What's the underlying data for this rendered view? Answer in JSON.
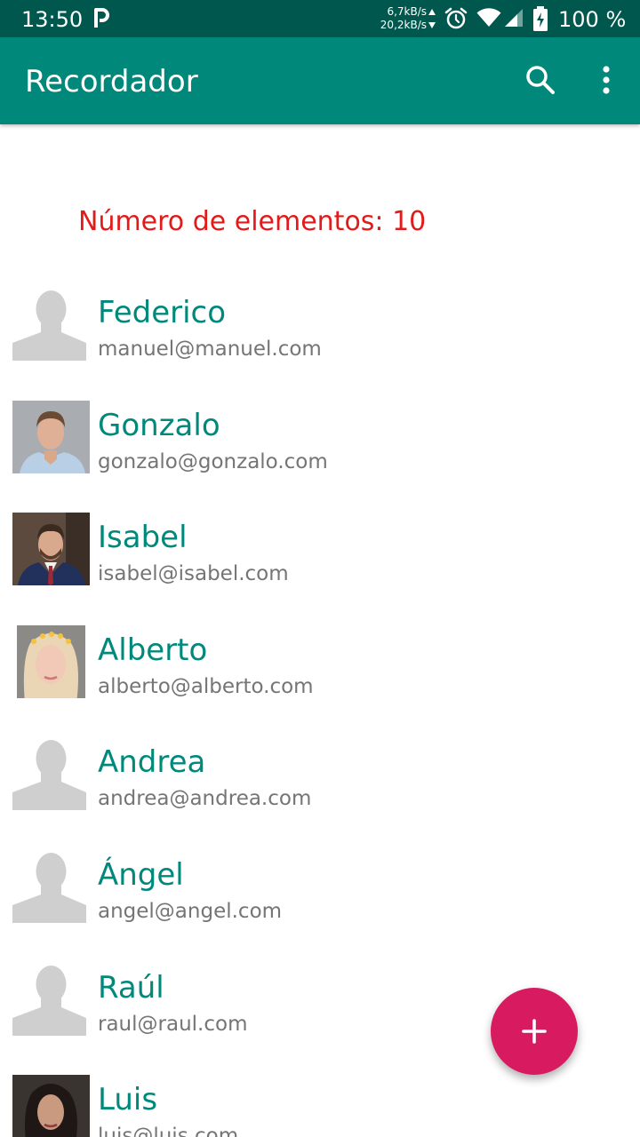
{
  "status_bar": {
    "time": "13:50",
    "net_up": "6,7kB/s",
    "net_down": "20,2kB/s",
    "battery_pct": "100 %",
    "icons": [
      "p-icon",
      "alarm-icon",
      "wifi-icon",
      "signal-icon",
      "battery-charging-icon"
    ]
  },
  "app_bar": {
    "title": "Recordador",
    "actions": [
      "search-icon",
      "more-vert-icon"
    ]
  },
  "counter": {
    "label": "Número de elementos: 10"
  },
  "contacts": [
    {
      "name": "Federico",
      "email": "manuel@manuel.com",
      "avatar": "placeholder"
    },
    {
      "name": "Gonzalo",
      "email": "gonzalo@gonzalo.com",
      "avatar": "photo-man-blue-shirt"
    },
    {
      "name": "Isabel",
      "email": "isabel@isabel.com",
      "avatar": "photo-man-suit"
    },
    {
      "name": "Alberto",
      "email": "alberto@alberto.com",
      "avatar": "photo-woman-blonde"
    },
    {
      "name": "Andrea",
      "email": "andrea@andrea.com",
      "avatar": "placeholder"
    },
    {
      "name": "Ángel",
      "email": "angel@angel.com",
      "avatar": "placeholder"
    },
    {
      "name": "Raúl",
      "email": "raul@raul.com",
      "avatar": "placeholder"
    },
    {
      "name": "Luis",
      "email": "luis@luis.com",
      "avatar": "photo-woman-dark-hair"
    }
  ],
  "fab": {
    "icon": "plus-icon"
  },
  "colors": {
    "status_bar": "#00574d",
    "app_bar": "#00897b",
    "name_text": "#00897b",
    "email_text": "#757575",
    "counter_text": "#e31a1a",
    "fab": "#d81b60",
    "placeholder_avatar": "#cfcfcf"
  }
}
